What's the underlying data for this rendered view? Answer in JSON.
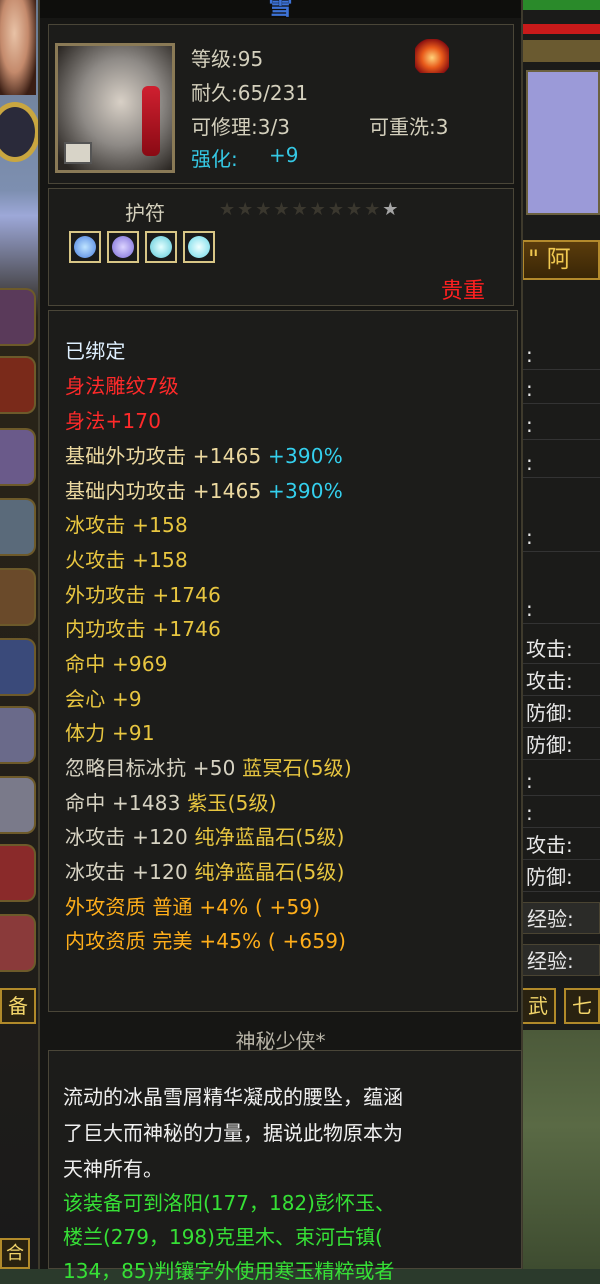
{
  "header": {
    "title_fragment": "雪"
  },
  "item": {
    "level": "等级:95",
    "durability": "耐久:65/231",
    "repairable": "可修理:3/3",
    "rewashable": "可重洗:3",
    "enhance_label": "强化:",
    "enhance_value": "+9",
    "type": "护符",
    "stars": "★★★★★★★★★",
    "stars_lit": "★",
    "rarity": "贵重",
    "icon": "jade-pendant-icon"
  },
  "gems": [
    {
      "icon": "blue-crystal-gem-icon",
      "color": "#4a7fe0"
    },
    {
      "icon": "purple-jade-gem-icon",
      "color": "#7a6ad8"
    },
    {
      "icon": "pure-blue-crystal-gem-icon",
      "color": "#5ac8d8"
    },
    {
      "icon": "pure-blue-crystal-gem-icon",
      "color": "#6ad8e8"
    }
  ],
  "attributes": [
    {
      "text": "已绑定",
      "color": "cyanwhite"
    },
    {
      "text": "身法雕纹7级",
      "color": "red"
    },
    {
      "text": "身法+170",
      "color": "red"
    },
    {
      "text": "基础外功攻击 +1465",
      "bonus": "+390%",
      "color": "yellow"
    },
    {
      "text": "基础内功攻击 +1465",
      "bonus": "+390%",
      "color": "yellow"
    },
    {
      "text": "冰攻击 +158",
      "color": "gold"
    },
    {
      "text": "火攻击 +158",
      "color": "gold"
    },
    {
      "text": "外功攻击 +1746",
      "color": "gold"
    },
    {
      "text": "内功攻击 +1746",
      "color": "gold"
    },
    {
      "text": "命中 +969",
      "color": "gold"
    },
    {
      "text": "会心 +9",
      "color": "gold"
    },
    {
      "text": "体力 +91",
      "color": "gold"
    },
    {
      "text": "忽略目标冰抗 +50",
      "gem": "蓝冥石(5级)",
      "color": "gray"
    },
    {
      "text": "命中 +1483",
      "gem": "紫玉(5级)",
      "color": "gray"
    },
    {
      "text": "冰攻击 +120",
      "gem": "纯净蓝晶石(5级)",
      "color": "gray"
    },
    {
      "text": "冰攻击 +120",
      "gem": "纯净蓝晶石(5级)",
      "color": "gray"
    },
    {
      "text": "外攻资质  普通 +4% ( +59)",
      "color": "orange"
    },
    {
      "text": "内攻资质  完美 +45% ( +659)",
      "color": "orange"
    }
  ],
  "set_name": "神秘少侠*",
  "description": [
    {
      "text": "流动的冰晶雪屑精华凝成的腰坠，蕴涵",
      "color": "white"
    },
    {
      "text": "了巨大而神秘的力量，据说此物原本为",
      "color": "white"
    },
    {
      "text": "天神所有。",
      "color": "white"
    },
    {
      "text": "该装备可到洛阳(177，182)彭怀玉、",
      "color": "green"
    },
    {
      "text": "楼兰(279，198)克里木、束河古镇(",
      "color": "green"
    },
    {
      "text": "134，85)判镶字外使用寒玉精粹或者",
      "color": "green"
    }
  ],
  "right_panel": {
    "title": "\" 阿",
    "rows": [
      ":",
      ":",
      ":",
      ":",
      ":",
      ":",
      "攻击:",
      "攻击:",
      "防御:",
      "防御:",
      ":",
      ":",
      "攻击:",
      "防御:"
    ],
    "exp1": "经验:",
    "exp2": "经验:",
    "tab1": "武",
    "tab2": "七"
  },
  "left_strip": {
    "bottom_tab": "备",
    "bottom_tab2": "合"
  }
}
